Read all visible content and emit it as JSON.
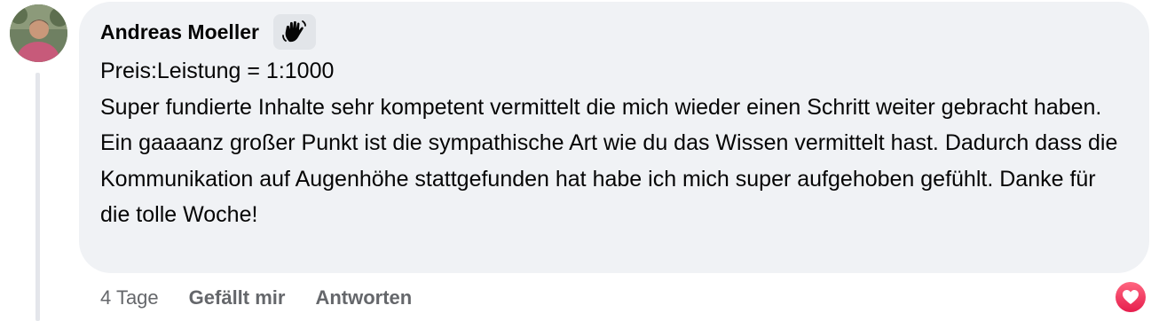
{
  "comment": {
    "author": "Andreas Moeller",
    "badge_icon": "hand-wave-icon",
    "lines": [
      "Preis:Leistung = 1:1000",
      "Super fundierte Inhalte sehr kompetent vermittelt die mich wieder einen Schritt weiter gebracht haben. Ein gaaaanz großer Punkt ist die sympathische Art wie du das Wissen vermittelt hast. Dadurch dass die Kommunikation auf Augenhöhe stattgefunden hat habe ich mich super aufgehoben gefühlt. Danke für die tolle Woche!"
    ]
  },
  "actions": {
    "time": "4 Tage",
    "like_label": "Gefällt mir",
    "reply_label": "Antworten"
  },
  "reaction": {
    "icon": "heart-reaction-icon",
    "color": "#f33e58"
  },
  "colors": {
    "bubble": "#f0f2f5",
    "text": "#050505",
    "secondary_text": "#65676b"
  }
}
